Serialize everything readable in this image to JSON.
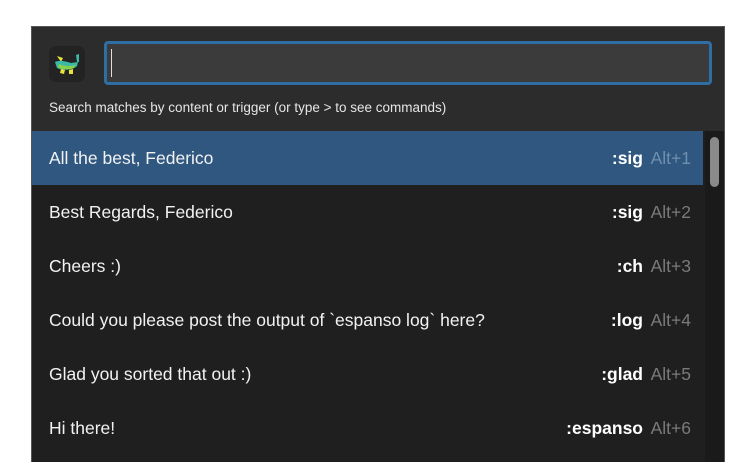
{
  "search": {
    "value": "",
    "hint": "Search matches by content or trigger (or type > to see commands)"
  },
  "logo": {
    "icon": "espanso-logo-icon"
  },
  "items": [
    {
      "label": "All the best, Federico",
      "trigger": ":sig",
      "shortcut": "Alt+1",
      "selected": true
    },
    {
      "label": "Best Regards, Federico",
      "trigger": ":sig",
      "shortcut": "Alt+2",
      "selected": false
    },
    {
      "label": "Cheers :)",
      "trigger": ":ch",
      "shortcut": "Alt+3",
      "selected": false
    },
    {
      "label": "Could you please post the output of `espanso log` here?",
      "trigger": ":log",
      "shortcut": "Alt+4",
      "selected": false
    },
    {
      "label": "Glad you sorted that out :)",
      "trigger": ":glad",
      "shortcut": "Alt+5",
      "selected": false
    },
    {
      "label": "Hi there!",
      "trigger": ":espanso",
      "shortcut": "Alt+6",
      "selected": false
    }
  ],
  "colors": {
    "selection": "#2f5780",
    "search_border": "#2f6ea5",
    "background": "#2c2c2c",
    "list_background": "#1f1f1f"
  }
}
